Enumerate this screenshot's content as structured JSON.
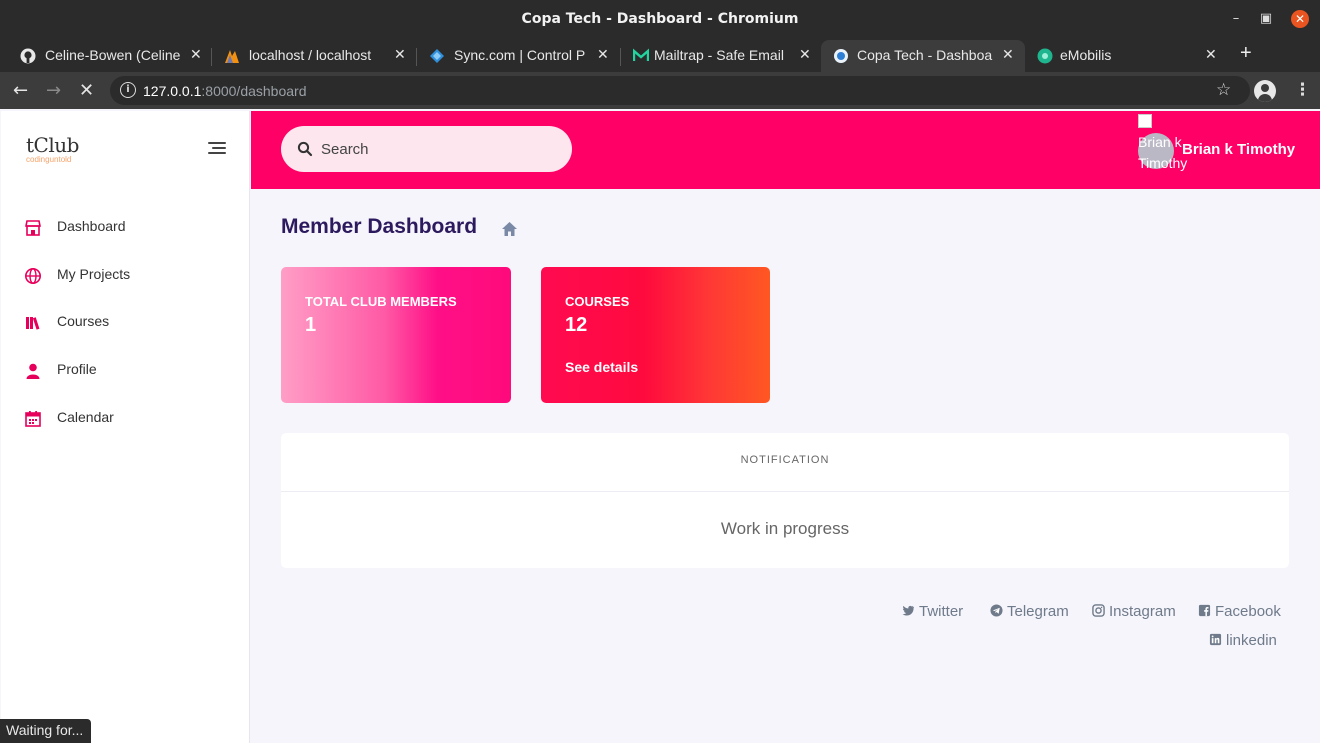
{
  "window": {
    "title": "Copa Tech - Dashboard - Chromium"
  },
  "tabs": [
    {
      "label": "Celine-Bowen (Celine",
      "icon": "github-icon"
    },
    {
      "label": "localhost / localhost",
      "icon": "phpmyadmin-icon"
    },
    {
      "label": "Sync.com | Control P",
      "icon": "sync-icon"
    },
    {
      "label": "Mailtrap - Safe Email",
      "icon": "mailtrap-icon"
    },
    {
      "label": "Copa Tech - Dashboa",
      "icon": "page-icon",
      "active": true
    },
    {
      "label": "eMobilis",
      "icon": "emobilis-icon"
    }
  ],
  "address": {
    "host": "127.0.0.1",
    "rest": ":8000/dashboard"
  },
  "sidebar": {
    "logo": "tClub",
    "logo_sub": "codinguntold",
    "items": [
      {
        "label": "Dashboard",
        "icon": "store-icon"
      },
      {
        "label": "My Projects",
        "icon": "globe-icon"
      },
      {
        "label": "Courses",
        "icon": "books-icon"
      },
      {
        "label": "Profile",
        "icon": "user-icon"
      },
      {
        "label": "Calendar",
        "icon": "calendar-icon"
      }
    ]
  },
  "header": {
    "search_placeholder": "Search",
    "avatar_alt": "Brian k Timothy",
    "username": "Brian k Timothy"
  },
  "main": {
    "title": "Member Dashboard",
    "cards": [
      {
        "label": "TOTAL CLUB MEMBERS",
        "value": "1"
      },
      {
        "label": "COURSES",
        "value": "12",
        "link": "See details"
      }
    ],
    "notification": {
      "header": "NOTIFICATION",
      "body": "Work in progress"
    },
    "social": [
      "Twitter",
      "Telegram",
      "Instagram",
      "Facebook",
      "linkedin"
    ]
  },
  "status_bar": "Waiting for...",
  "colors": {
    "accent": "#ff0066",
    "sidebar_icon": "#e6005c",
    "title": "#2d1a5e"
  }
}
